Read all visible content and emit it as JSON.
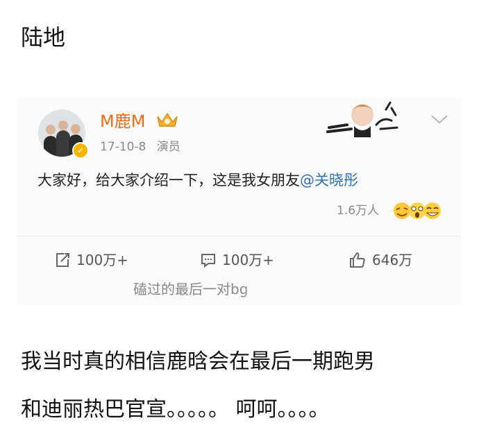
{
  "heading": "陆地",
  "card": {
    "username": "M鹿M",
    "date": "17-10-8",
    "source": "演员",
    "post_text": "大家好，给大家介绍一下，这是我女朋友",
    "mention": "@关晓彤",
    "reactions_count": "1.6万人",
    "actions": {
      "repost": "100万+",
      "comment": "100万+",
      "like": "646万"
    },
    "watermark": "磕过的最后一对bg"
  },
  "body": {
    "line1": "我当时真的相信鹿晗会在最后一期跑男",
    "line2": "和迪丽热巴官宣。。。。。 呵呵。。。。"
  },
  "colors": {
    "username": "#f36b14",
    "mention": "#2f6fb5",
    "verified_badge": "#f7b500"
  }
}
